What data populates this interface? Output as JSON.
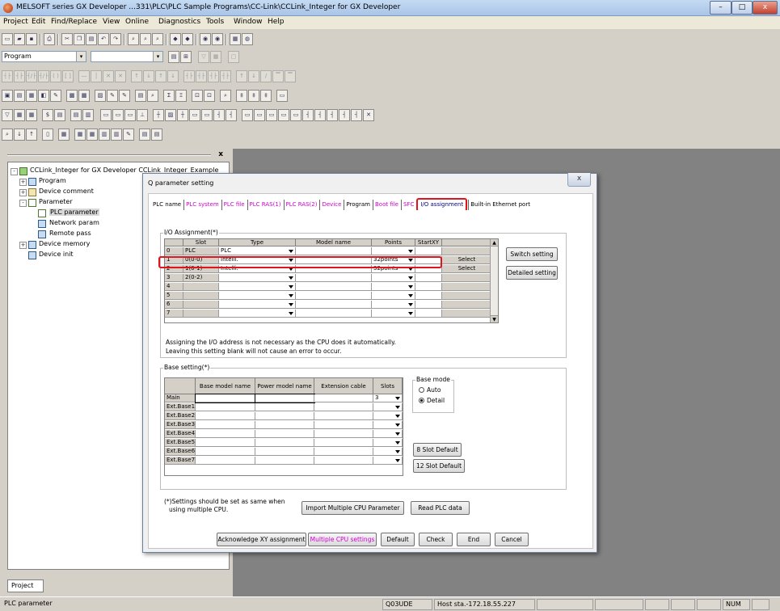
{
  "window": {
    "title": "MELSOFT series GX Developer ...331\\PLC\\PLC Sample Programs\\CC-Link\\CCLink_Integer for GX Developer",
    "min": "–",
    "max": "□",
    "close": "x"
  },
  "menu": [
    "Project",
    "Edit",
    "Find/Replace",
    "View",
    "Online",
    "Diagnostics",
    "Tools",
    "Window",
    "Help"
  ],
  "toolbar": {
    "program_combo": "Program",
    "second_combo": "",
    "combo_arrow": "▾"
  },
  "tree": {
    "root": "CCLink_Integer for GX Developer CCLink_Integer_Example",
    "items": [
      {
        "label": "Program",
        "pm": "+"
      },
      {
        "label": "Device comment",
        "pm": "+"
      },
      {
        "label": "Parameter",
        "pm": "-"
      },
      {
        "label": "PLC parameter",
        "pm": ""
      },
      {
        "label": "Network param",
        "pm": ""
      },
      {
        "label": "Remote pass",
        "pm": ""
      },
      {
        "label": "Device memory",
        "pm": "+"
      },
      {
        "label": "Device init",
        "pm": ""
      }
    ],
    "root_pm": "-"
  },
  "dock_close": "x",
  "project_tab": "Project",
  "status": {
    "left": "PLC parameter",
    "cpu": "Q03UDE",
    "host": "Host sta.-172.18.55.227",
    "num": "NUM"
  },
  "dialog": {
    "title": "Q parameter setting",
    "close": "x",
    "tabs": [
      "PLC name",
      "PLC system",
      "PLC file",
      "PLC RAS(1)",
      "PLC RAS(2)",
      "Device",
      "Program",
      "Boot file",
      "SFC",
      "I/O assignment",
      "Built-in Ethernet port"
    ],
    "active_tab": "I/O assignment",
    "io": {
      "label": "I/O Assignment(*)",
      "headers": [
        "Slot",
        "Type",
        "Model name",
        "Points",
        "StartXY"
      ],
      "rows": [
        {
          "no": "0",
          "slot": "PLC",
          "type": "PLC",
          "model": "",
          "points": "",
          "start": "",
          "detail": ""
        },
        {
          "no": "1",
          "slot": "0(0-0)",
          "type": "Intelli.",
          "model": "",
          "points": "32points",
          "start": "",
          "detail": "Select"
        },
        {
          "no": "2",
          "slot": "1(0-1)",
          "type": "Intelli.",
          "model": "",
          "points": "32points",
          "start": "",
          "detail": "Select"
        },
        {
          "no": "3",
          "slot": "2(0-2)",
          "type": "",
          "model": "",
          "points": "",
          "start": "",
          "detail": ""
        },
        {
          "no": "4",
          "slot": "",
          "type": "",
          "model": "",
          "points": "",
          "start": "",
          "detail": ""
        },
        {
          "no": "5",
          "slot": "",
          "type": "",
          "model": "",
          "points": "",
          "start": "",
          "detail": ""
        },
        {
          "no": "6",
          "slot": "",
          "type": "",
          "model": "",
          "points": "",
          "start": "",
          "detail": ""
        },
        {
          "no": "7",
          "slot": "",
          "type": "",
          "model": "",
          "points": "",
          "start": "",
          "detail": ""
        }
      ],
      "switch_setting": "Switch setting",
      "detailed_setting": "Detailed setting",
      "note1": "Assigning the I/O address is not necessary as the CPU does it automatically.",
      "note2": "Leaving this setting blank will not cause an error to occur."
    },
    "base": {
      "label": "Base setting(*)",
      "headers": [
        "Base model name",
        "Power model name",
        "Extension cable",
        "Slots"
      ],
      "rows": [
        {
          "name": "Main",
          "slots": "3"
        },
        {
          "name": "Ext.Base1",
          "slots": ""
        },
        {
          "name": "Ext.Base2",
          "slots": ""
        },
        {
          "name": "Ext.Base3",
          "slots": ""
        },
        {
          "name": "Ext.Base4",
          "slots": ""
        },
        {
          "name": "Ext.Base5",
          "slots": ""
        },
        {
          "name": "Ext.Base6",
          "slots": ""
        },
        {
          "name": "Ext.Base7",
          "slots": ""
        }
      ],
      "mode_label": "Base mode",
      "mode_auto": "Auto",
      "mode_detail": "Detail",
      "mode_selected": "Detail",
      "slot8": "8 Slot Default",
      "slot12": "12 Slot Default"
    },
    "multi_note1": "(*)Settings should be set as same when",
    "multi_note2": "using multiple CPU.",
    "import_btn": "Import Multiple CPU Parameter",
    "read_btn": "Read PLC data",
    "buttons": {
      "ack": "Acknowledge XY assignment",
      "multi": "Multiple CPU settings",
      "default": "Default",
      "check": "Check",
      "end": "End",
      "cancel": "Cancel"
    }
  }
}
